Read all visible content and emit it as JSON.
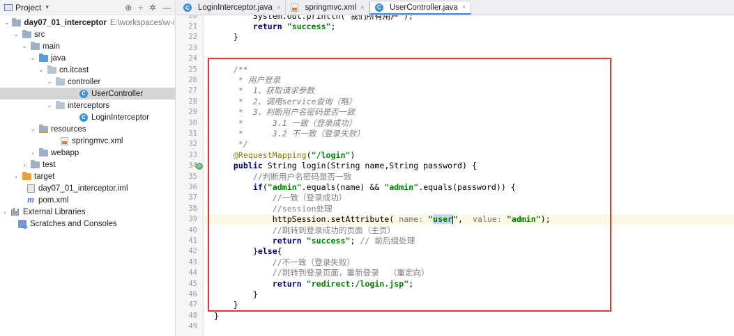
{
  "project_panel": {
    "title": "Project",
    "tree": [
      {
        "label": "day07_01_interceptor",
        "path": "E:\\workspaces\\w-ide",
        "icon": "module-folder-icon",
        "arrow": "expanded",
        "bold": true
      },
      {
        "label": "src",
        "icon": "folder-icon",
        "arrow": "expanded"
      },
      {
        "label": "main",
        "icon": "folder-icon",
        "arrow": "expanded"
      },
      {
        "label": "java",
        "icon": "source-folder-icon",
        "arrow": "expanded"
      },
      {
        "label": "cn.itcast",
        "icon": "package-icon",
        "arrow": "expanded"
      },
      {
        "label": "controller",
        "icon": "package-icon",
        "arrow": "expanded"
      },
      {
        "label": "UserController",
        "icon": "class-icon",
        "arrow": "none",
        "selected": true
      },
      {
        "label": "interceptors",
        "icon": "package-icon",
        "arrow": "expanded"
      },
      {
        "label": "LoginInterceptor",
        "icon": "class-icon",
        "arrow": "none"
      },
      {
        "label": "resources",
        "icon": "resources-folder-icon",
        "arrow": "expanded"
      },
      {
        "label": "springmvc.xml",
        "icon": "xml-file-icon",
        "arrow": "none"
      },
      {
        "label": "webapp",
        "icon": "folder-icon",
        "arrow": "collapsed"
      },
      {
        "label": "test",
        "icon": "folder-icon",
        "arrow": "collapsed"
      },
      {
        "label": "target",
        "icon": "excluded-folder-icon",
        "arrow": "collapsed"
      },
      {
        "label": "day07_01_interceptor.iml",
        "icon": "iml-file-icon",
        "arrow": "none"
      },
      {
        "label": "pom.xml",
        "icon": "maven-file-icon",
        "arrow": "none"
      },
      {
        "label": "External Libraries",
        "icon": "libraries-icon",
        "arrow": "collapsed"
      },
      {
        "label": "Scratches and Consoles",
        "icon": "scratches-icon",
        "arrow": "none"
      }
    ]
  },
  "tabs": [
    {
      "label": "LoginInterceptor.java",
      "icon": "class-icon",
      "active": false
    },
    {
      "label": "springmvc.xml",
      "icon": "xml-file-icon",
      "active": false
    },
    {
      "label": "UserController.java",
      "icon": "class-icon",
      "active": true
    }
  ],
  "code": {
    "current_line": 39,
    "gutter_icon_line": 34,
    "lines": [
      {
        "n": "20",
        "parts": [
          {
            "t": "        System.out.println(\"我们所有用户\");",
            "c": "partial"
          }
        ]
      },
      {
        "n": "21",
        "parts": [
          {
            "t": "        ",
            "c": ""
          },
          {
            "t": "return",
            "c": "kw"
          },
          {
            "t": " ",
            "c": ""
          },
          {
            "t": "\"success\"",
            "c": "str"
          },
          {
            "t": ";",
            "c": ""
          }
        ]
      },
      {
        "n": "22",
        "parts": [
          {
            "t": "    }",
            "c": ""
          }
        ]
      },
      {
        "n": "23",
        "parts": []
      },
      {
        "n": "24",
        "parts": []
      },
      {
        "n": "25",
        "parts": [
          {
            "t": "    /**",
            "c": "cmi"
          }
        ]
      },
      {
        "n": "26",
        "parts": [
          {
            "t": "     * 用户登录",
            "c": "cmi"
          }
        ]
      },
      {
        "n": "27",
        "parts": [
          {
            "t": "     *  1、获取请求参数",
            "c": "cmi"
          }
        ]
      },
      {
        "n": "28",
        "parts": [
          {
            "t": "     *  2、调用service查询（略）",
            "c": "cmi"
          }
        ]
      },
      {
        "n": "29",
        "parts": [
          {
            "t": "     *  3、判断用户名密码是否一致",
            "c": "cmi"
          }
        ]
      },
      {
        "n": "30",
        "parts": [
          {
            "t": "     *      3.1 一致（登录成功）",
            "c": "cmi"
          }
        ]
      },
      {
        "n": "31",
        "parts": [
          {
            "t": "     *      3.2 不一致（登录失败）",
            "c": "cmi"
          }
        ]
      },
      {
        "n": "32",
        "parts": [
          {
            "t": "     */",
            "c": "cmi"
          }
        ]
      },
      {
        "n": "33",
        "parts": [
          {
            "t": "    ",
            "c": ""
          },
          {
            "t": "@RequestMapping",
            "c": "ann"
          },
          {
            "t": "(",
            "c": ""
          },
          {
            "t": "\"/login\"",
            "c": "str"
          },
          {
            "t": ")",
            "c": ""
          }
        ]
      },
      {
        "n": "34",
        "parts": [
          {
            "t": "    ",
            "c": ""
          },
          {
            "t": "public",
            "c": "kw"
          },
          {
            "t": " String ",
            "c": ""
          },
          {
            "t": "login",
            "c": "meth"
          },
          {
            "t": "(String name,String password) {",
            "c": ""
          }
        ]
      },
      {
        "n": "35",
        "parts": [
          {
            "t": "        //判断用户名密码是否一致",
            "c": "cm"
          }
        ]
      },
      {
        "n": "36",
        "parts": [
          {
            "t": "        ",
            "c": ""
          },
          {
            "t": "if",
            "c": "kw"
          },
          {
            "t": "(",
            "c": ""
          },
          {
            "t": "\"admin\"",
            "c": "str"
          },
          {
            "t": ".equals(name) && ",
            "c": ""
          },
          {
            "t": "\"admin\"",
            "c": "str"
          },
          {
            "t": ".equals(password)) {",
            "c": ""
          }
        ]
      },
      {
        "n": "37",
        "parts": [
          {
            "t": "            //一致（登录成功）",
            "c": "cm"
          }
        ]
      },
      {
        "n": "38",
        "parts": [
          {
            "t": "            //session处理",
            "c": "cm"
          }
        ]
      },
      {
        "n": "39",
        "parts": [
          {
            "t": "            httpSession.setAttribute( ",
            "c": ""
          },
          {
            "t": "name: ",
            "c": "hint"
          },
          {
            "t": "\"",
            "c": "str"
          },
          {
            "t": "user",
            "c": "strsel"
          },
          {
            "t": "\"",
            "c": "str"
          },
          {
            "t": ",  ",
            "c": ""
          },
          {
            "t": "value: ",
            "c": "hint"
          },
          {
            "t": "\"admin\"",
            "c": "str"
          },
          {
            "t": ");",
            "c": ""
          }
        ]
      },
      {
        "n": "40",
        "parts": [
          {
            "t": "            //跳转到登录成功的页面（主页）",
            "c": "cm"
          }
        ]
      },
      {
        "n": "41",
        "parts": [
          {
            "t": "            ",
            "c": ""
          },
          {
            "t": "return",
            "c": "kw"
          },
          {
            "t": " ",
            "c": ""
          },
          {
            "t": "\"success\"",
            "c": "str"
          },
          {
            "t": "; ",
            "c": ""
          },
          {
            "t": "// 前后缀处理",
            "c": "cm"
          }
        ]
      },
      {
        "n": "42",
        "parts": [
          {
            "t": "        }",
            "c": ""
          },
          {
            "t": "else",
            "c": "kw"
          },
          {
            "t": "{",
            "c": ""
          }
        ]
      },
      {
        "n": "43",
        "parts": [
          {
            "t": "            //不一致（登录失败）",
            "c": "cm"
          }
        ]
      },
      {
        "n": "44",
        "parts": [
          {
            "t": "            //跳转到登录页面，重新登录  （重定向）",
            "c": "cm"
          }
        ]
      },
      {
        "n": "45",
        "parts": [
          {
            "t": "            ",
            "c": ""
          },
          {
            "t": "return",
            "c": "kw"
          },
          {
            "t": " ",
            "c": ""
          },
          {
            "t": "\"redirect:/login.jsp\"",
            "c": "str"
          },
          {
            "t": ";",
            "c": ""
          }
        ]
      },
      {
        "n": "46",
        "parts": [
          {
            "t": "        }",
            "c": ""
          }
        ]
      },
      {
        "n": "47",
        "parts": [
          {
            "t": "    }",
            "c": ""
          }
        ]
      },
      {
        "n": "48",
        "parts": [
          {
            "t": "}",
            "c": ""
          }
        ]
      },
      {
        "n": "49",
        "parts": []
      }
    ]
  },
  "colors": {
    "highlight_box": "#e3342f",
    "keyword": "#000080",
    "string": "#008000",
    "comment": "#808080",
    "annotation": "#808000",
    "active_tab_underline": "#4a86e8",
    "selected_tree_row": "#d5d5d5"
  }
}
